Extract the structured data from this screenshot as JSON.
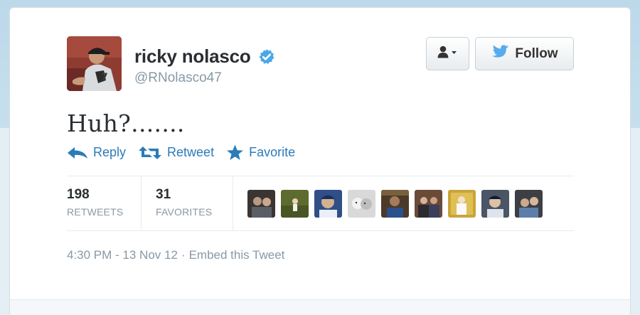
{
  "user": {
    "display_name": "ricky nolasco",
    "handle": "@RNolasco47",
    "verified_icon": "verified-badge-icon"
  },
  "buttons": {
    "user_menu_icon": "user-dropdown-icon",
    "follow_label": "Follow"
  },
  "tweet": {
    "text": "Huh?......."
  },
  "actions": {
    "reply": "Reply",
    "retweet": "Retweet",
    "favorite": "Favorite"
  },
  "stats": {
    "retweets_count": "198",
    "retweets_label": "RETWEETS",
    "favorites_count": "31",
    "favorites_label": "FAVORITES"
  },
  "meta": {
    "timestamp": "4:30 PM - 13 Nov 12",
    "separator": "·",
    "embed": "Embed this Tweet"
  },
  "colors": {
    "link": "#2b7bb9",
    "verified": "#4aa8e8",
    "muted": "#8899a6",
    "text": "#292f33"
  }
}
